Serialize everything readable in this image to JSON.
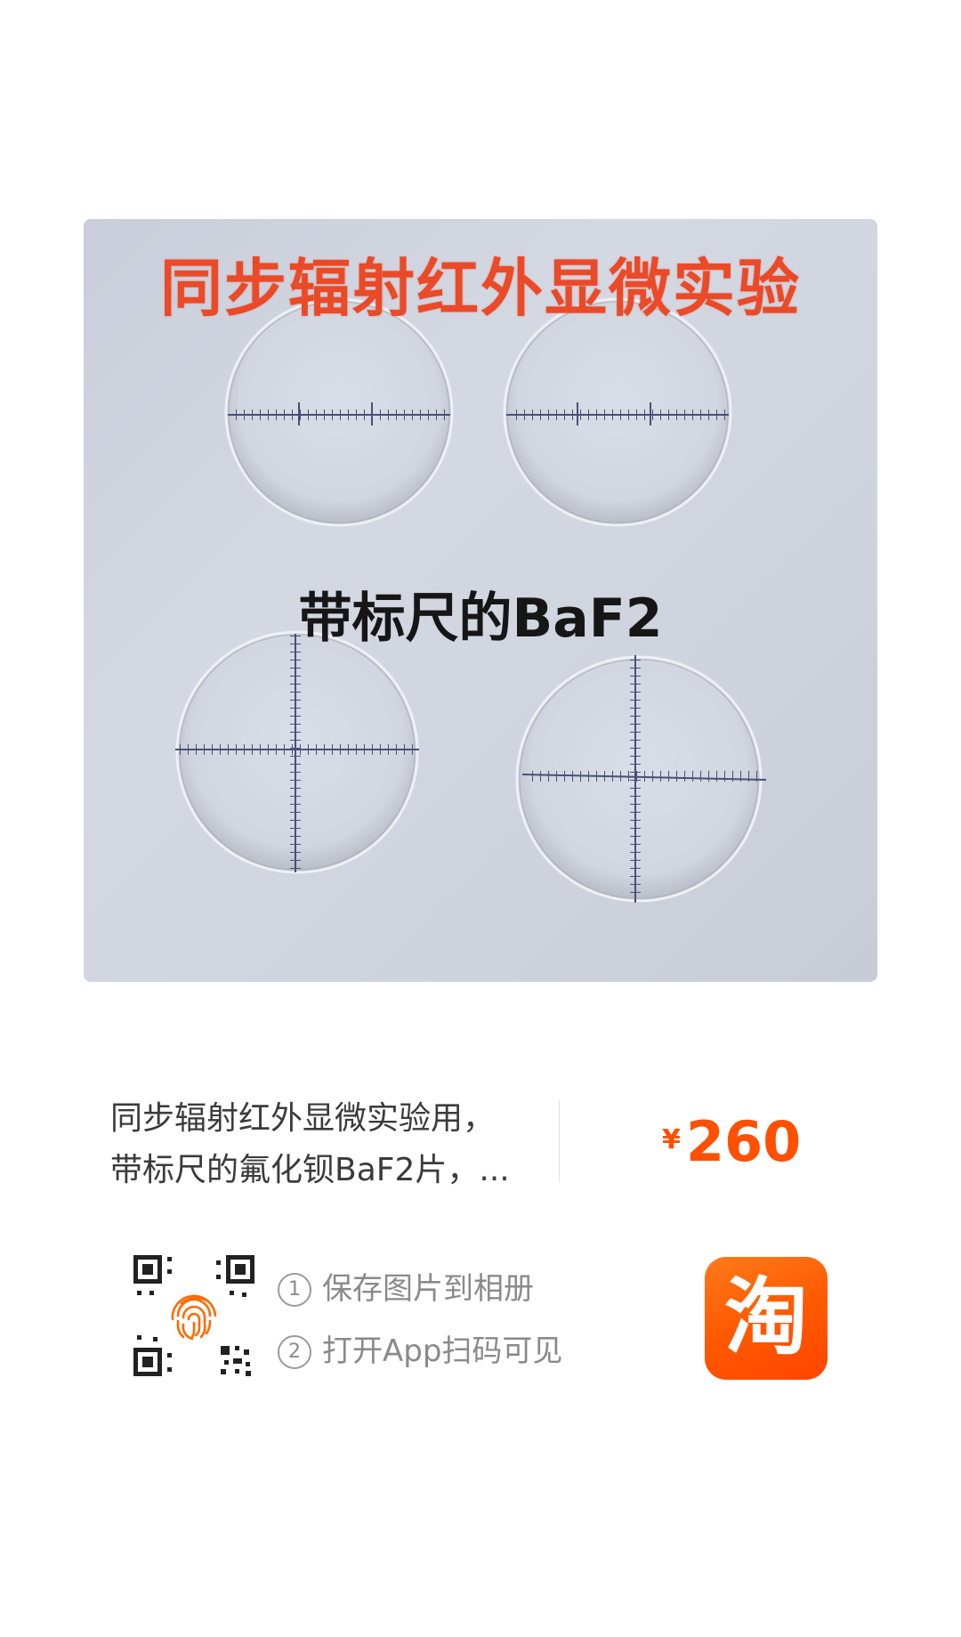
{
  "product_image": {
    "title": "同步辐射红外显微实验",
    "subtitle": "带标尺的BaF2"
  },
  "product": {
    "title_line1": "同步辐射红外显微实验用，",
    "title_line2": "带标尺的氟化钡BaF2片，...",
    "currency": "¥",
    "price": "260"
  },
  "instructions": {
    "step1_num": "1",
    "step1": "保存图片到相册",
    "step2_num": "2",
    "step2": "打开App扫码可见"
  },
  "app": {
    "logo_char": "淘",
    "brand_color": "#ff5000"
  }
}
